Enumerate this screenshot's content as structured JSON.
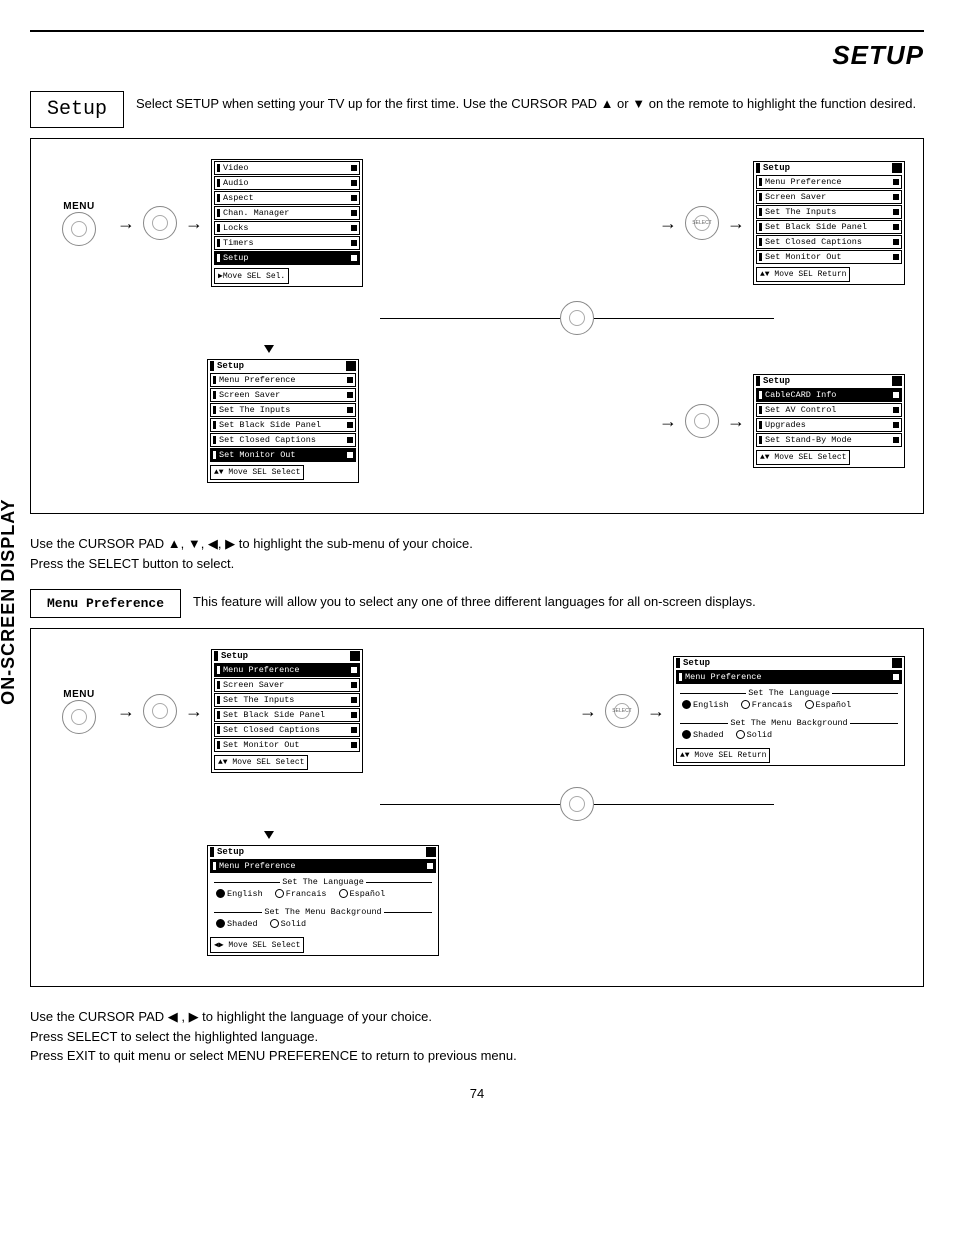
{
  "page_title": "SETUP",
  "setup_box_label": "Setup",
  "setup_desc": "Select SETUP when setting your TV up for the first time.  Use the CURSOR PAD ▲ or ▼ on the remote to highlight the function desired.",
  "menu_label": "MENU",
  "osd_main": {
    "items": [
      "Video",
      "Audio",
      "Aspect",
      "Chan. Manager",
      "Locks",
      "Timers",
      "Setup"
    ],
    "highlight_index": 6,
    "foot": "▶Move  SEL Sel."
  },
  "osd_setup1": {
    "title": "Setup",
    "items": [
      "Menu Preference",
      "Screen Saver",
      "Set The Inputs",
      "Set Black Side Panel",
      "Set Closed Captions",
      "Set Monitor Out"
    ],
    "highlight_index": -1,
    "foot": "▲▼ Move  SEL Return"
  },
  "osd_setup2": {
    "title": "Setup",
    "items": [
      "Menu Preference",
      "Screen Saver",
      "Set The Inputs",
      "Set Black Side Panel",
      "Set Closed Captions",
      "Set Monitor Out"
    ],
    "highlight_index": 5,
    "foot": "▲▼ Move  SEL Select"
  },
  "osd_setup3": {
    "title": "Setup",
    "items": [
      "CableCARD Info",
      "Set AV Control",
      "Upgrades",
      "Set Stand-By Mode"
    ],
    "highlight_index": 0,
    "foot": "▲▼ Move  SEL Select"
  },
  "mid_para": "Use the CURSOR PAD ▲, ▼, ◀, ▶ to highlight the sub-menu of your choice.\nPress the SELECT button to select.",
  "menupref_box": "Menu Preference",
  "menupref_desc": "This feature will allow you to select any one of three different languages for all on-screen displays.",
  "osd_pref1": {
    "title": "Setup",
    "items": [
      "Menu Preference",
      "Screen Saver",
      "Set The Inputs",
      "Set Black Side Panel",
      "Set Closed Captions",
      "Set Monitor Out"
    ],
    "highlight_index": 0,
    "foot": "▲▼ Move  SEL Select"
  },
  "osd_pref_detail": {
    "title": "Setup",
    "sub": "Menu Preference",
    "lang_legend": "Set The Language",
    "lang_opts": [
      "English",
      "Francais",
      "Español"
    ],
    "lang_sel": 0,
    "bg_legend": "Set The Menu Background",
    "bg_opts": [
      "Shaded",
      "Solid"
    ],
    "bg_sel": 0,
    "foot": "▲▼ Move  SEL Return"
  },
  "osd_pref_detail2": {
    "title": "Setup",
    "sub": "Menu Preference",
    "lang_legend": "Set The Language",
    "lang_opts": [
      "English",
      "Francais",
      "Español"
    ],
    "lang_sel": 0,
    "bg_legend": "Set The Menu Background",
    "bg_opts": [
      "Shaded",
      "Solid"
    ],
    "bg_sel": 0,
    "foot": "◀▶ Move  SEL Select"
  },
  "bottom_para": "Use the CURSOR PAD ◀ , ▶ to highlight the language of your choice.\nPress SELECT to select the highlighted language.\nPress EXIT to quit menu or select MENU PREFERENCE to return to previous menu.",
  "side_tab": "ON-SCREEN DISPLAY",
  "page_number": "74"
}
